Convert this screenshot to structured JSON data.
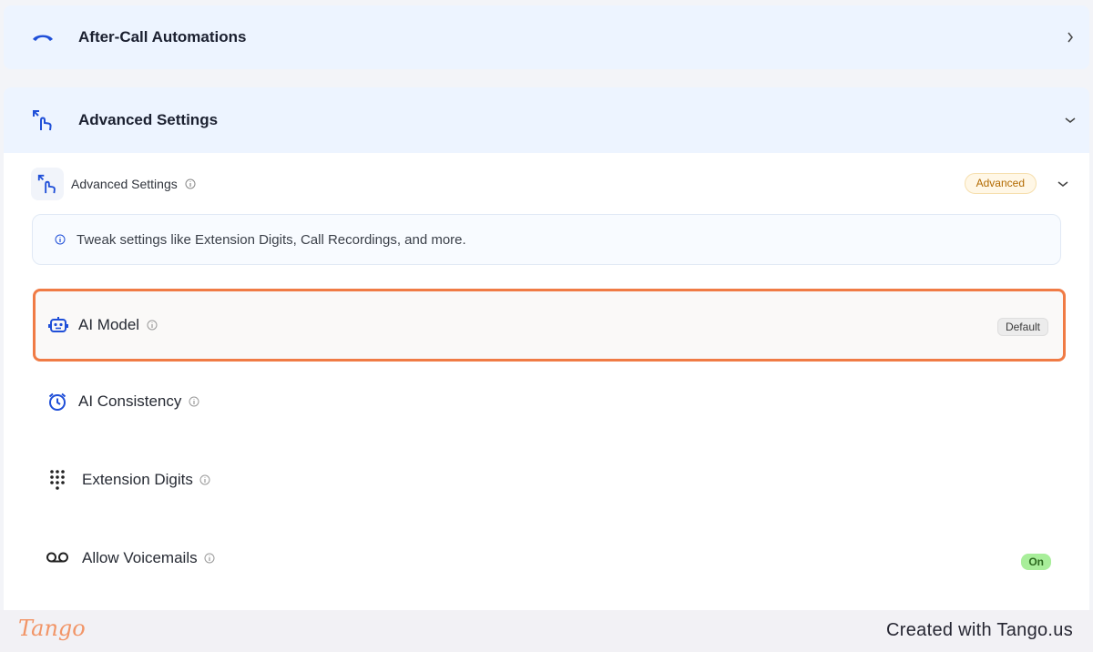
{
  "panels": {
    "after_call": {
      "title": "After-Call Automations",
      "icon": "phone-hangup-icon"
    },
    "advanced": {
      "title": "Advanced Settings",
      "icon": "touch-expand-icon"
    }
  },
  "advanced_section": {
    "title": "Advanced Settings",
    "badge": "Advanced",
    "note": "Tweak settings like Extension Digits, Call Recordings, and more."
  },
  "settings": [
    {
      "label": "AI Model",
      "icon": "robot-icon",
      "badge": "Default"
    },
    {
      "label": "AI Consistency",
      "icon": "alarm-clock-icon"
    },
    {
      "label": "Extension Digits",
      "icon": "dialpad-icon"
    },
    {
      "label": "Allow Voicemails",
      "icon": "voicemail-icon",
      "badge": "On"
    }
  ],
  "footer": {
    "logo": "Tango",
    "credit": "Created with Tango.us"
  },
  "colors": {
    "accent_blue": "#1f4fd8",
    "highlight": "#f07b45",
    "on_badge": "#a8ee9a"
  }
}
